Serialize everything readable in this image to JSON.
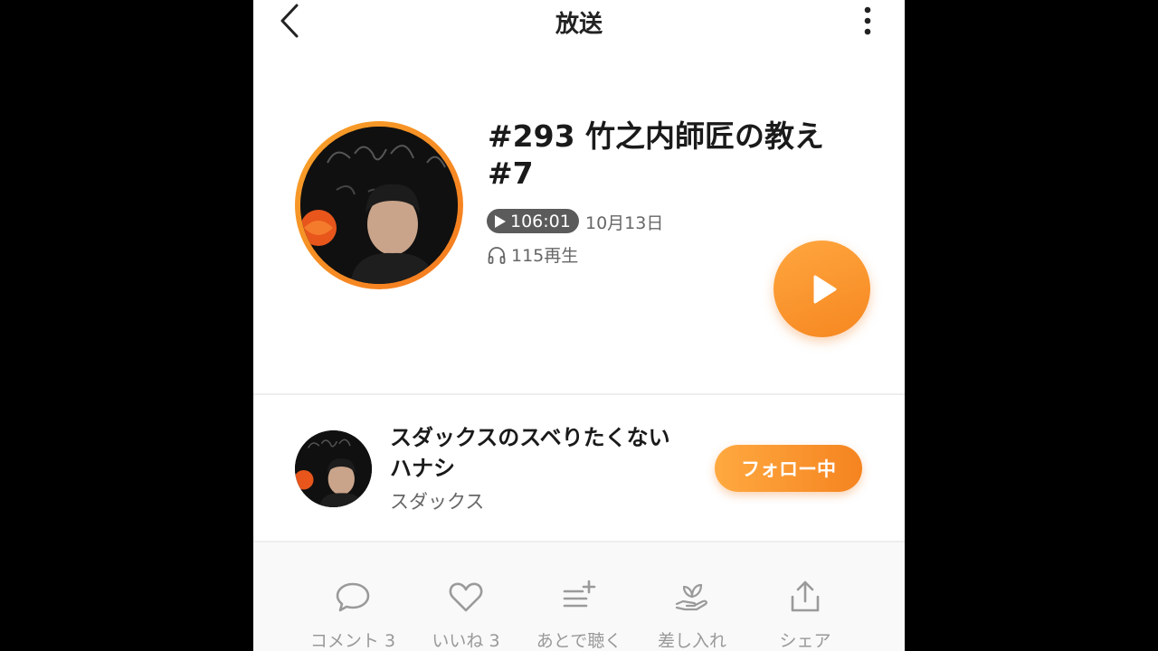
{
  "header": {
    "title": "放送"
  },
  "episode": {
    "title_line1": "#293 竹之内師匠の教え",
    "title_line2": "#7",
    "duration": "106:01",
    "date": "10月13日",
    "plays": "115再生"
  },
  "channel": {
    "title_line1": "スダックスのスベりたくない",
    "title_line2": "ハナシ",
    "author": "スダックス",
    "follow_label": "フォロー中"
  },
  "actions": [
    {
      "label": "コメント 3",
      "icon": "comment-icon"
    },
    {
      "label": "いいね 3",
      "icon": "heart-icon"
    },
    {
      "label": "あとで聴く",
      "icon": "playlist-add-icon"
    },
    {
      "label": "差し入れ",
      "icon": "gift-hand-icon"
    },
    {
      "label": "シェア",
      "icon": "share-icon"
    }
  ],
  "colors": {
    "accent": "#f68720",
    "background": "#ffffff",
    "frame": "#000000"
  }
}
